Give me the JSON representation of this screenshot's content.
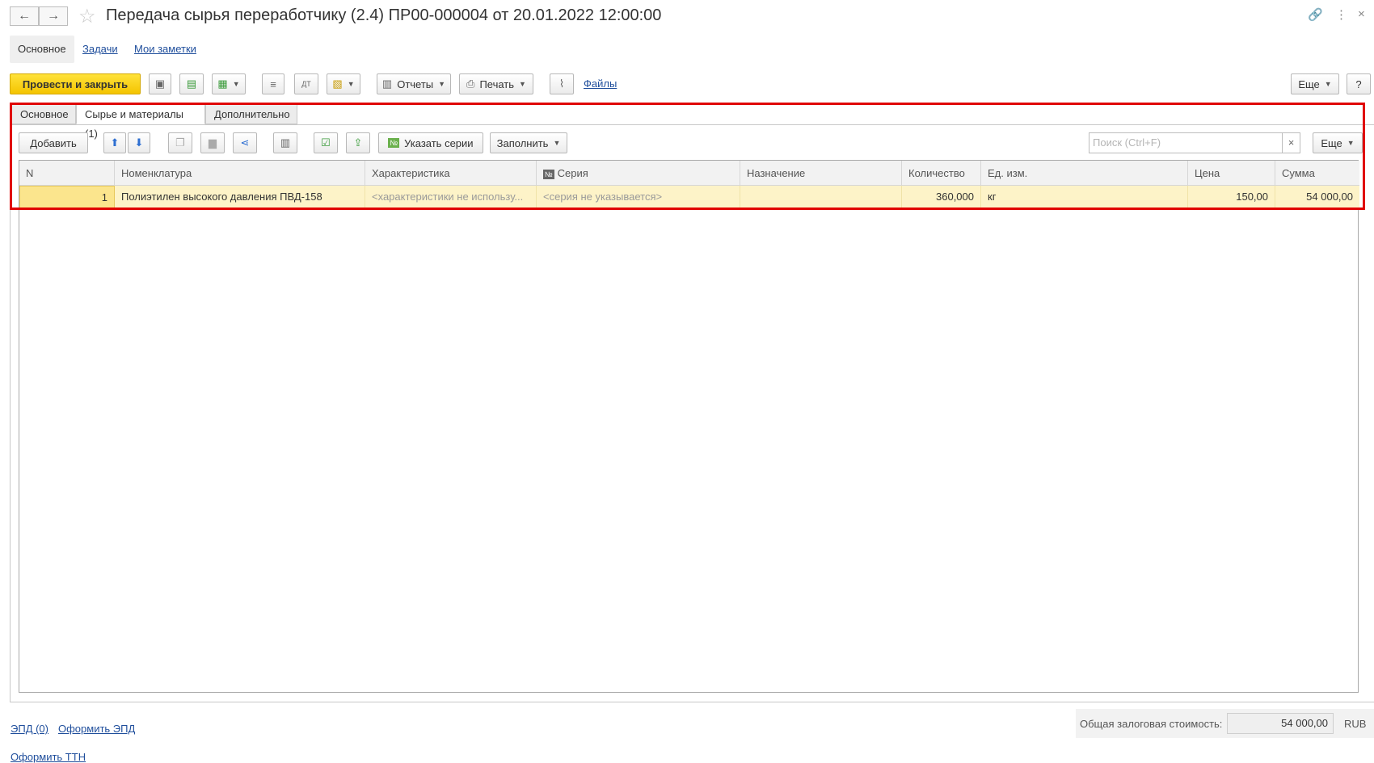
{
  "window": {
    "title": "Передача сырья переработчику (2.4) ПР00-000004 от 20.01.2022 12:00:00",
    "back_icon": "←",
    "forward_icon": "→",
    "star_icon": "☆",
    "link_icon": "🔗",
    "menu_icon": "⋮",
    "close_icon": "×"
  },
  "nav_tabs": [
    {
      "label": "Основное"
    },
    {
      "label": "Задачи"
    },
    {
      "label": "Мои заметки"
    }
  ],
  "toolbar": {
    "post_close_label": "Провести и закрыть",
    "reports_label": "Отчеты",
    "print_label": "Печать",
    "files_label": "Файлы",
    "more_label": "Еще",
    "help_label": "?"
  },
  "form_tabs": [
    {
      "label": "Основное"
    },
    {
      "label": "Сырье и материалы (1)"
    },
    {
      "label": "Дополнительно"
    }
  ],
  "table_toolbar": {
    "add_label": "Добавить",
    "series_label": "Указать серии",
    "fill_label": "Заполнить",
    "search_placeholder": "Поиск (Ctrl+F)",
    "search_clear": "×",
    "more_label": "Еще"
  },
  "table": {
    "columns": [
      "N",
      "Номенклатура",
      "Характеристика",
      "Серия",
      "Назначение",
      "Количество",
      "Ед. изм.",
      "Цена",
      "Сумма"
    ],
    "rows": [
      {
        "n": "1",
        "nomenclature": "Полиэтилен высокого давления ПВД-158",
        "characteristic": "<характеристики не использу...",
        "series": "<серия не указывается>",
        "purpose": "",
        "quantity": "360,000",
        "unit": "кг",
        "price": "150,00",
        "sum": "54 000,00"
      }
    ]
  },
  "footer": {
    "epd_label": "ЭПД (0)",
    "make_epd_label": "Оформить ЭПД",
    "make_ttn_label": "Оформить ТТН",
    "total_label": "Общая залоговая стоимость:",
    "total_value": "54 000,00",
    "currency": "RUB"
  },
  "colors": {
    "primary_button": "#f4c400",
    "selected_row": "#fdf3c8",
    "highlight_frame": "#e00000",
    "link": "#1f4e9c"
  }
}
